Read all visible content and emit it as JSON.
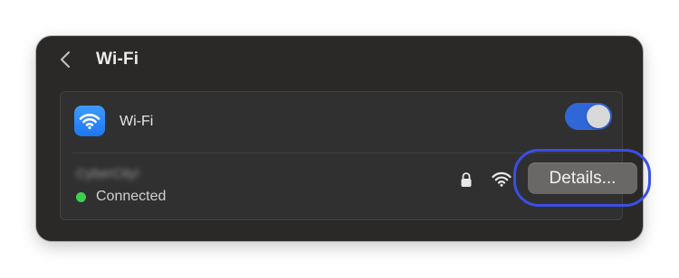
{
  "header": {
    "back_icon": "chevron-left-icon",
    "title": "Wi-Fi"
  },
  "wifi_row": {
    "icon": "wifi-icon",
    "icon_color": "#1f77f0",
    "label": "Wi-Fi",
    "toggle_on": true,
    "toggle_color": "#2f67d9"
  },
  "network": {
    "name": "CyberCity!",
    "status": "Connected",
    "status_color": "#3ecf4e",
    "lock_icon": "lock-icon",
    "signal_icon": "wifi-signal-icon",
    "details_label": "Details..."
  },
  "highlight_color": "#3a4fe6"
}
